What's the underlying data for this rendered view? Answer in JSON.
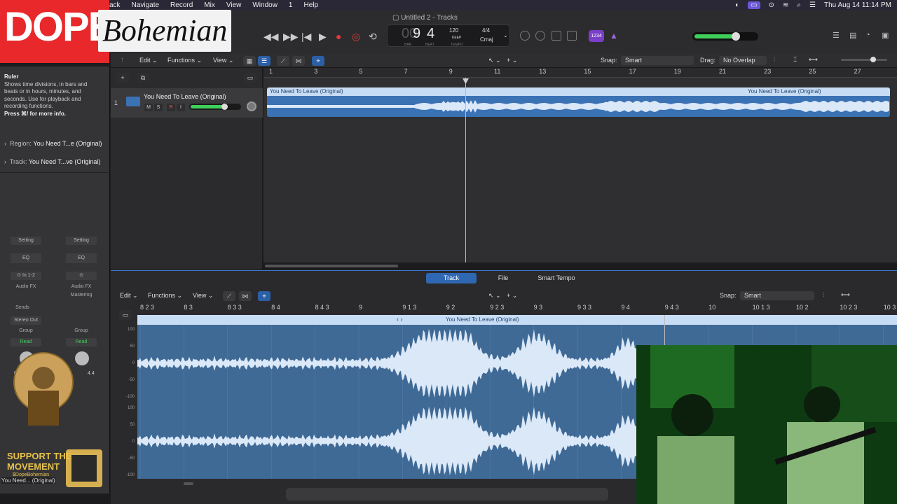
{
  "menubar": {
    "items": [
      "ack",
      "Navigate",
      "Record",
      "Mix",
      "View",
      "Window",
      "1",
      "Help"
    ],
    "datetime": "Thu Aug 14  11:14 PM"
  },
  "watermark": {
    "dope": "DOPE",
    "bohemian": "Bohemian"
  },
  "window": {
    "title": "Untitled 2 - Tracks"
  },
  "lcd": {
    "bar": "9",
    "beat": "4",
    "bar_label": "BAR",
    "beat_label": "BEAT",
    "tempo": "120",
    "tempo_keep": "KEEP",
    "tempo_label": "TEMPO",
    "signature": "4/4",
    "key": "Cmaj"
  },
  "count_in_badge": "1234",
  "master_volume": 0.62,
  "inspector": {
    "help_title": "Ruler",
    "help_body": "Shows time divisions, in bars and beats or in hours, minutes, and seconds. Use for playback and recording functions.",
    "help_shortcut": "Press ⌘/ for more info.",
    "region_label": "Region:",
    "region_value": "You Need T...e (Original)",
    "track_label": "Track:",
    "track_value": "You Need T...ve (Original)",
    "strip1": {
      "setting": "Setting",
      "eq": "EQ",
      "input": "In 1-2",
      "fx": "Audio FX",
      "sends": "Sends",
      "output": "Stereo Out",
      "group": "Group",
      "read": "Read",
      "pan": "0.0"
    },
    "strip2": {
      "setting": "Setting",
      "eq": "EQ",
      "fx": "Audio FX",
      "fx2": "Mastering",
      "group": "Group",
      "read": "Read",
      "level": "4.4"
    },
    "channel_name": "You Need... (Original)"
  },
  "promo": {
    "line1": "SUPPORT THE",
    "line2": "MOVEMENT",
    "handle": "$DopeBohemian"
  },
  "tracks_toolbar": {
    "edit": "Edit",
    "functions": "Functions",
    "view": "View",
    "snap_label": "Snap:",
    "snap_value": "Smart",
    "drag_label": "Drag:",
    "drag_value": "No Overlap"
  },
  "track": {
    "number": "1",
    "name": "You Need To Leave (Original)",
    "mute": "M",
    "solo": "S",
    "rec": "R",
    "input": "I",
    "volume": 0.68
  },
  "ruler_ticks": [
    "1",
    "3",
    "5",
    "7",
    "9",
    "11",
    "13",
    "15",
    "17",
    "19",
    "21",
    "23",
    "25",
    "27"
  ],
  "region_label": "You Need To Leave (Original)",
  "editor": {
    "tabs": [
      "Track",
      "File",
      "Smart Tempo"
    ],
    "edit": "Edit",
    "functions": "Functions",
    "view": "View",
    "snap_label": "Snap:",
    "snap_value": "Smart",
    "ruler_ticks": [
      "8 2 3",
      "8 3",
      "8 3 3",
      "8 4",
      "8 4 3",
      "9",
      "9 1 3",
      "9 2",
      "9 2 3",
      "9 3",
      "9 3 3",
      "9 4",
      "9 4 3",
      "10",
      "10 1 3",
      "10 2",
      "10 2 3",
      "10 3"
    ],
    "region_label": "You Need To Leave (Original)",
    "y_ticks": [
      "100",
      "50",
      "0",
      "-50",
      "-100",
      "100",
      "50",
      "0",
      "-50",
      "-100"
    ]
  }
}
